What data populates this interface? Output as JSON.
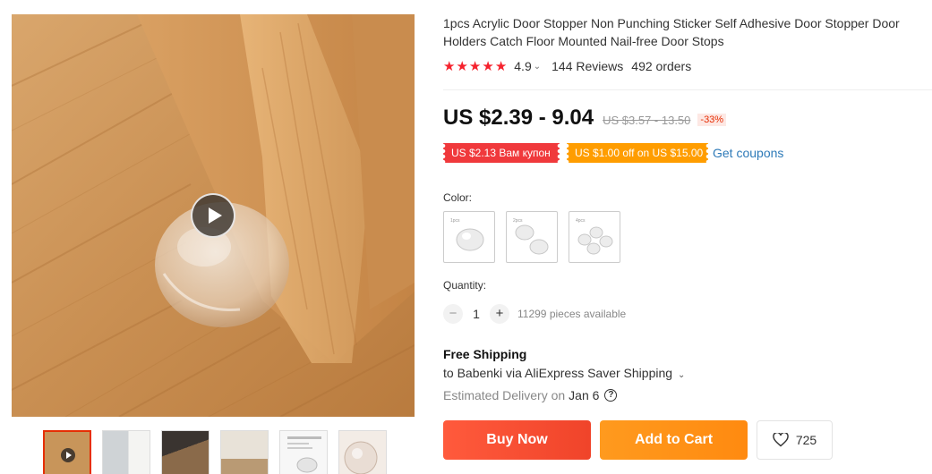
{
  "product": {
    "title": "1pcs Acrylic Door Stopper Non Punching Sticker Self Adhesive Door Stopper Door Holders Catch Floor Mounted Nail-free Door Stops",
    "rating": "4.9",
    "rating_chevron": "⌄",
    "stars": [
      "★",
      "★",
      "★",
      "★",
      "★"
    ],
    "reviews": "144 Reviews",
    "orders": "492 orders"
  },
  "price": {
    "current": "US $2.39 - 9.04",
    "original": "US $3.57 - 13.50",
    "discount": "-33%"
  },
  "coupons": {
    "items": [
      "US $2.13 Вам купон",
      "US $1.00 off on US $15.00"
    ],
    "get_label": "Get coupons"
  },
  "color": {
    "label": "Color:",
    "options": [
      "1pcs",
      "2pcs",
      "4pcs"
    ]
  },
  "quantity": {
    "label": "Quantity:",
    "minus": "−",
    "plus": "+",
    "value": "1",
    "available": "11299 pieces available"
  },
  "shipping": {
    "title": "Free Shipping",
    "destination": "to Babenki via AliExpress Saver Shipping",
    "chevron": "⌄",
    "delivery_label": "Estimated Delivery on",
    "delivery_date": "Jan 6",
    "help": "?"
  },
  "actions": {
    "buy": "Buy Now",
    "cart": "Add to Cart",
    "wishlist_count": "725"
  },
  "colors": {
    "accent_red": "#f5222d",
    "buy_button": "#f0442a",
    "cart_button": "#ff8a10",
    "link": "#2e7ab8"
  },
  "icons": {
    "play": "play-icon",
    "heart": "heart-icon",
    "help": "question-circle-icon"
  }
}
